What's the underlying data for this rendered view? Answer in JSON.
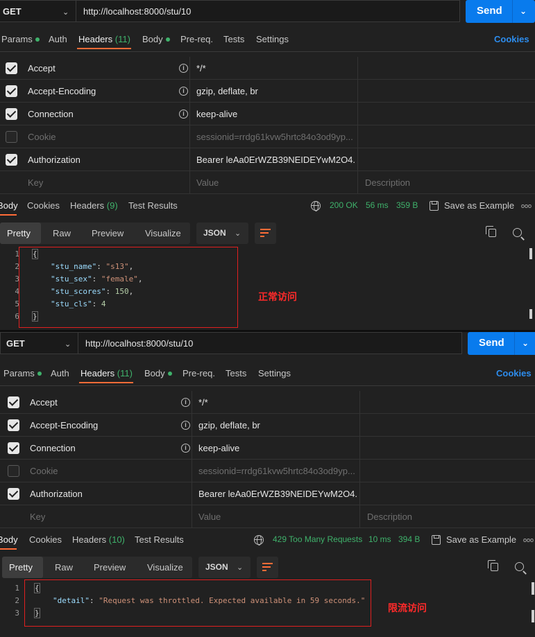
{
  "panels": [
    {
      "request": {
        "method": "GET",
        "url": "http://localhost:8000/stu/10",
        "send_label": "Send"
      },
      "tabs": {
        "params": "Params",
        "auth": "Auth",
        "headers": "Headers",
        "headers_count": "(11)",
        "body": "Body",
        "prereq": "Pre-req.",
        "tests": "Tests",
        "settings": "Settings",
        "cookies": "Cookies"
      },
      "header_rows": [
        {
          "key": "Accept",
          "value": "*/*",
          "checked": true
        },
        {
          "key": "Accept-Encoding",
          "value": "gzip, deflate, br",
          "checked": true
        },
        {
          "key": "Connection",
          "value": "keep-alive",
          "checked": true
        },
        {
          "key": "Cookie",
          "value": "sessionid=rrdg61kvw5hrtc84o3od9yp...",
          "checked": false
        },
        {
          "key": "Authorization",
          "value": "Bearer leAa0ErWZB39NEIDEYwM2O4...",
          "checked": true
        }
      ],
      "placeholders": {
        "key": "Key",
        "value": "Value",
        "description": "Description"
      },
      "response_tabs": {
        "body": "Body",
        "cookies": "Cookies",
        "headers": "Headers",
        "headers_count": "(9)",
        "test_results": "Test Results"
      },
      "status": {
        "code": "200 OK",
        "time": "56 ms",
        "size": "359 B",
        "save": "Save as Example",
        "more": "ooo"
      },
      "view": {
        "pretty": "Pretty",
        "raw": "Raw",
        "preview": "Preview",
        "visualize": "Visualize",
        "format": "JSON"
      },
      "code": {
        "line_numbers": [
          "1",
          "2",
          "3",
          "4",
          "5",
          "6"
        ],
        "open": "{",
        "close": "}",
        "lines": [
          {
            "key": "\"stu_name\"",
            "value": "\"s13\"",
            "type": "str"
          },
          {
            "key": "\"stu_sex\"",
            "value": "\"female\"",
            "type": "str"
          },
          {
            "key": "\"stu_scores\"",
            "value": "150",
            "type": "num"
          },
          {
            "key": "\"stu_cls\"",
            "value": "4",
            "type": "num"
          }
        ]
      },
      "annotation": "正常访问"
    },
    {
      "request": {
        "method": "GET",
        "url": "http://localhost:8000/stu/10",
        "send_label": "Send"
      },
      "tabs": {
        "params": "Params",
        "auth": "Auth",
        "headers": "Headers",
        "headers_count": "(11)",
        "body": "Body",
        "prereq": "Pre-req.",
        "tests": "Tests",
        "settings": "Settings",
        "cookies": "Cookies"
      },
      "header_rows": [
        {
          "key": "Accept",
          "value": "*/*",
          "checked": true
        },
        {
          "key": "Accept-Encoding",
          "value": "gzip, deflate, br",
          "checked": true
        },
        {
          "key": "Connection",
          "value": "keep-alive",
          "checked": true
        },
        {
          "key": "Cookie",
          "value": "sessionid=rrdg61kvw5hrtc84o3od9yp...",
          "checked": false
        },
        {
          "key": "Authorization",
          "value": "Bearer leAa0ErWZB39NEIDEYwM2O4...",
          "checked": true
        }
      ],
      "placeholders": {
        "key": "Key",
        "value": "Value",
        "description": "Description"
      },
      "response_tabs": {
        "body": "Body",
        "cookies": "Cookies",
        "headers": "Headers",
        "headers_count": "(10)",
        "test_results": "Test Results"
      },
      "status": {
        "code": "429 Too Many Requests",
        "time": "10 ms",
        "size": "394 B",
        "save": "Save as Example",
        "more": "ooo"
      },
      "view": {
        "pretty": "Pretty",
        "raw": "Raw",
        "preview": "Preview",
        "visualize": "Visualize",
        "format": "JSON"
      },
      "code": {
        "line_numbers": [
          "1",
          "2",
          "3"
        ],
        "open": "{",
        "close": "}",
        "lines": [
          {
            "key": "\"detail\"",
            "value": "\"Request was throttled. Expected available in 59 seconds.\"",
            "type": "str"
          }
        ]
      },
      "annotation": "限流访问"
    }
  ],
  "colors": {
    "accent": "#ff6c37",
    "send": "#097bed",
    "ok": "#3fb26b",
    "annotation": "#e02020",
    "cookies_link": "#2d8dee"
  },
  "icons": [
    "info-icon",
    "globe-icon",
    "save-icon",
    "copy-icon",
    "search-icon",
    "wrap-lines-icon",
    "chevron-down-icon",
    "more-icon"
  ]
}
